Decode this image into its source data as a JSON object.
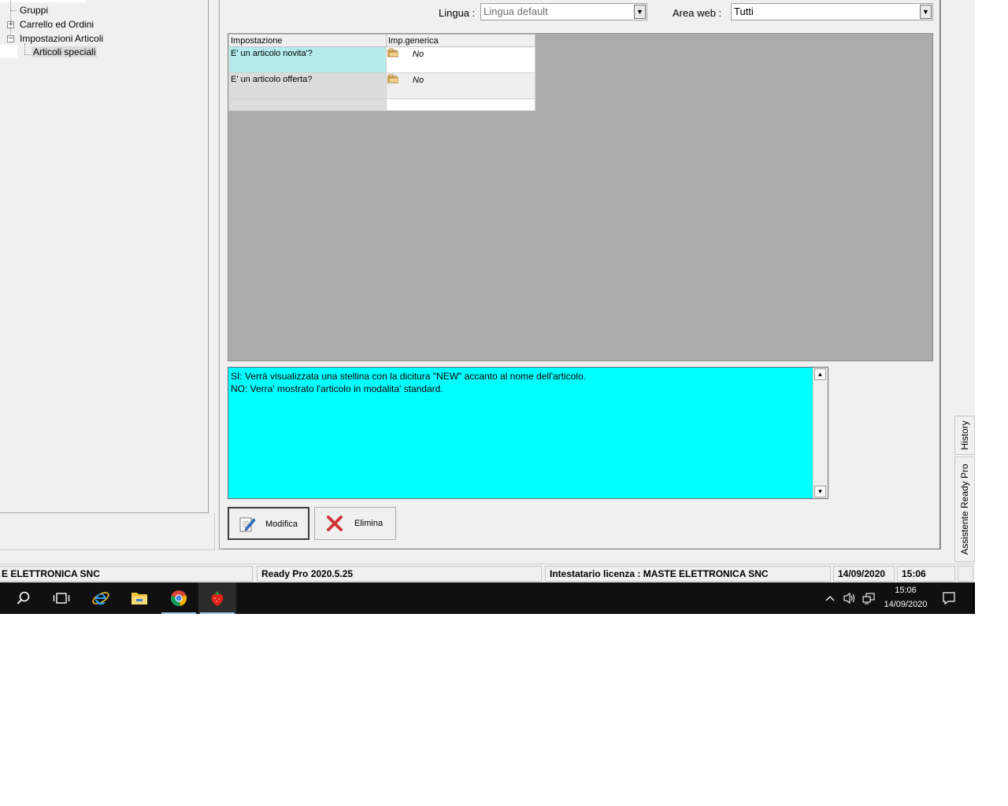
{
  "tree": {
    "items": [
      {
        "label": "Gruppi"
      },
      {
        "label": "Carrello ed Ordini",
        "expander": "+"
      },
      {
        "label": "Impostazioni Articoli",
        "expander": "−"
      },
      {
        "label": "Articoli speciali"
      }
    ]
  },
  "filters": {
    "lingua_label": "Lingua :",
    "lingua_value": "Lingua default",
    "area_label": "Area web :",
    "area_value": "Tutti"
  },
  "grid": {
    "columns": [
      "Impostazione",
      "Imp.generica"
    ],
    "rows": [
      {
        "setting": "E' un articolo novita'?",
        "value": "No"
      },
      {
        "setting": "E' un articolo offerta?",
        "value": "No"
      }
    ]
  },
  "memo": {
    "text": "SI: Verrà visualizzata una stellina con la dicitura \"NEW\" accanto al nome dell'articolo.\nNO: Verra' mostrato l'articolo in modalita' standard."
  },
  "buttons": {
    "modifica": "Modifica",
    "elimina": "Elimina"
  },
  "side_tabs": {
    "history": "History",
    "assistente": "Assistente Ready Pro"
  },
  "status_bar": {
    "company": "E ELETTRONICA SNC",
    "version": "Ready Pro 2020.5.25",
    "license": "Intestatario licenza : MASTE ELETTRONICA SNC",
    "date": "14/09/2020",
    "time": "15:06"
  },
  "taskbar": {
    "clock_time": "15:06",
    "clock_date": "14/09/2020",
    "icons": [
      "search-icon",
      "task-view-icon",
      "internet-explorer-icon",
      "file-explorer-icon",
      "chrome-icon",
      "ready-pro-strawberry-icon"
    ],
    "tray_icons": [
      "chevron-up-icon",
      "volume-icon",
      "network-icon",
      "notification-icon"
    ]
  },
  "colors": {
    "memo_background": "#00ffff",
    "active_row": "#b4ecec",
    "grid_background": "#ababab",
    "taskbar": "#101010",
    "delete_red": "#d13438"
  }
}
